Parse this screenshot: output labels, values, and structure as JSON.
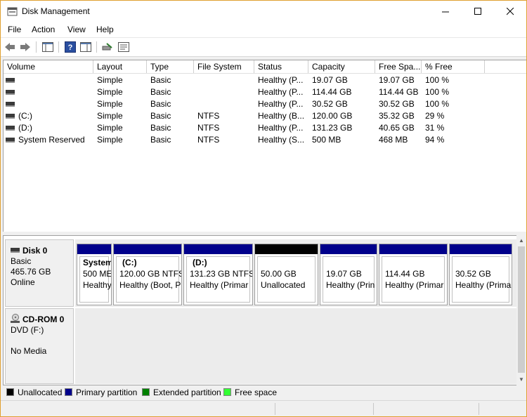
{
  "window": {
    "title": "Disk Management"
  },
  "menu": {
    "file": "File",
    "action": "Action",
    "view": "View",
    "help": "Help"
  },
  "volumes": {
    "columns": [
      "Volume",
      "Layout",
      "Type",
      "File System",
      "Status",
      "Capacity",
      "Free Spa...",
      "% Free"
    ],
    "rows": [
      {
        "volume": "",
        "layout": "Simple",
        "type": "Basic",
        "fs": "",
        "status": "Healthy (P...",
        "capacity": "19.07 GB",
        "free": "19.07 GB",
        "pct": "100 %"
      },
      {
        "volume": "",
        "layout": "Simple",
        "type": "Basic",
        "fs": "",
        "status": "Healthy (P...",
        "capacity": "114.44 GB",
        "free": "114.44 GB",
        "pct": "100 %"
      },
      {
        "volume": "",
        "layout": "Simple",
        "type": "Basic",
        "fs": "",
        "status": "Healthy (P...",
        "capacity": "30.52 GB",
        "free": "30.52 GB",
        "pct": "100 %"
      },
      {
        "volume": "(C:)",
        "layout": "Simple",
        "type": "Basic",
        "fs": "NTFS",
        "status": "Healthy (B...",
        "capacity": "120.00 GB",
        "free": "35.32 GB",
        "pct": "29 %"
      },
      {
        "volume": "(D:)",
        "layout": "Simple",
        "type": "Basic",
        "fs": "NTFS",
        "status": "Healthy (P...",
        "capacity": "131.23 GB",
        "free": "40.65 GB",
        "pct": "31 %"
      },
      {
        "volume": "System Reserved",
        "layout": "Simple",
        "type": "Basic",
        "fs": "NTFS",
        "status": "Healthy (S...",
        "capacity": "500 MB",
        "free": "468 MB",
        "pct": "94 %"
      }
    ]
  },
  "disks": {
    "disk0": {
      "name": "Disk 0",
      "type": "Basic",
      "size": "465.76 GB",
      "state": "Online",
      "partitions": [
        {
          "name": "System",
          "size": "500 ME",
          "status": "Healthy",
          "kind": "primary"
        },
        {
          "name": "(C:)",
          "size": "120.00 GB NTFS",
          "status": "Healthy (Boot, P",
          "kind": "primary"
        },
        {
          "name": "(D:)",
          "size": "131.23 GB NTFS",
          "status": "Healthy (Primar",
          "kind": "primary"
        },
        {
          "name": "",
          "size": "50.00 GB",
          "status": "Unallocated",
          "kind": "unallocated"
        },
        {
          "name": "",
          "size": "19.07 GB",
          "status": "Healthy (Prin",
          "kind": "primary"
        },
        {
          "name": "",
          "size": "114.44 GB",
          "status": "Healthy (Primar",
          "kind": "primary"
        },
        {
          "name": "",
          "size": "30.52 GB",
          "status": "Healthy (Prima",
          "kind": "primary"
        }
      ]
    },
    "cdrom0": {
      "name": "CD-ROM 0",
      "type": "DVD (F:)",
      "state": "No Media"
    }
  },
  "legend": {
    "unallocated": "Unallocated",
    "primary": "Primary partition",
    "extended": "Extended partition",
    "free": "Free space",
    "colors": {
      "unallocated": "#000000",
      "primary": "#00008b",
      "extended": "#008000",
      "free": "#33ff33"
    }
  }
}
